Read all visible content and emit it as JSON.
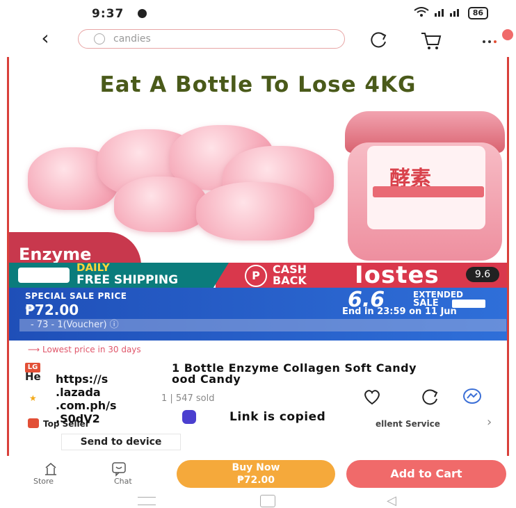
{
  "status_bar": {
    "time": "9:37",
    "battery": "86"
  },
  "search": {
    "value": "candies"
  },
  "product": {
    "headline": "Eat A Bottle To Lose 4KG",
    "image_tag": "Enzyme",
    "jar_label_cn": "酵素",
    "promo": {
      "daily": "DAILY",
      "free_shipping": "FREE SHIPPING",
      "cash": "CASH",
      "back": "BACK",
      "brand_text": "Iostes",
      "badge": "9.6"
    },
    "price_panel": {
      "special_label": "SPECIAL SALE PRICE",
      "price": "₱72.00",
      "voucher": "- 73 - 1(Voucher) ⓘ",
      "sale_number": "6.6",
      "sale_extended": "EXTENDED",
      "sale_label": "SALE",
      "countdown": "End in 23:59 on 11 Jun"
    },
    "lowest_price": "⟶ Lowest price in 30 days",
    "lazmall_tag": "LG",
    "title_prefix": "He",
    "title_line1": "1 Bottle Enzyme Collagen Soft Candy",
    "title_line2": "ood Candy",
    "sold": "1 | 547 sold",
    "top_seller": "Top Seller",
    "service": "ellent Service"
  },
  "popup": {
    "link": "https://s\n.lazada\n.com.ph/s\n.S0dV2",
    "copied": "Link is copied",
    "send_to_device": "Send to device"
  },
  "bottom_bar": {
    "store": "Store",
    "chat": "Chat",
    "buy_now": "Buy Now",
    "buy_now_price": "₱72.00",
    "add_to_cart": "Add to Cart"
  },
  "colors": {
    "headline": "#4a5a1a",
    "shipping_strip": "#0b7c7c",
    "cashback_strip": "#d9384c",
    "price_panel": "#2f6fd9",
    "buy_now": "#f5a93b",
    "add_to_cart": "#f06a6a"
  }
}
